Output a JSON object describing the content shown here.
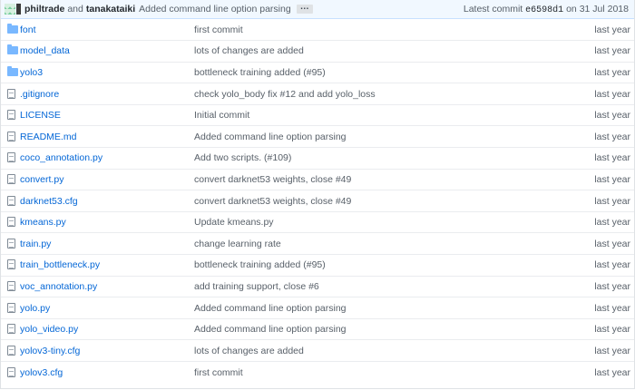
{
  "commit": {
    "author1": "philtrade",
    "and": "and",
    "author2": "tanakataiki",
    "message": "Added command line option parsing",
    "ellipsis": "…",
    "latest_label": "Latest commit",
    "sha": "e6598d1",
    "date": "on 31 Jul 2018"
  },
  "files": [
    {
      "type": "folder",
      "name": "font",
      "message": "first commit",
      "age": "last year"
    },
    {
      "type": "folder",
      "name": "model_data",
      "message": "lots of changes are added",
      "age": "last year"
    },
    {
      "type": "folder",
      "name": "yolo3",
      "message": "bottleneck training added (#95)",
      "age": "last year"
    },
    {
      "type": "file",
      "name": ".gitignore",
      "message": "check yolo_body fix #12 and add yolo_loss",
      "age": "last year"
    },
    {
      "type": "file",
      "name": "LICENSE",
      "message": "Initial commit",
      "age": "last year"
    },
    {
      "type": "file",
      "name": "README.md",
      "message": "Added command line option parsing",
      "age": "last year"
    },
    {
      "type": "file",
      "name": "coco_annotation.py",
      "message": "Add two scripts. (#109)",
      "age": "last year"
    },
    {
      "type": "file",
      "name": "convert.py",
      "message": "convert darknet53 weights, close #49",
      "age": "last year"
    },
    {
      "type": "file",
      "name": "darknet53.cfg",
      "message": "convert darknet53 weights, close #49",
      "age": "last year"
    },
    {
      "type": "file",
      "name": "kmeans.py",
      "message": "Update kmeans.py",
      "age": "last year"
    },
    {
      "type": "file",
      "name": "train.py",
      "message": "change learning rate",
      "age": "last year"
    },
    {
      "type": "file",
      "name": "train_bottleneck.py",
      "message": "bottleneck training added (#95)",
      "age": "last year"
    },
    {
      "type": "file",
      "name": "voc_annotation.py",
      "message": "add training support, close #6",
      "age": "last year"
    },
    {
      "type": "file",
      "name": "yolo.py",
      "message": "Added command line option parsing",
      "age": "last year"
    },
    {
      "type": "file",
      "name": "yolo_video.py",
      "message": "Added command line option parsing",
      "age": "last year"
    },
    {
      "type": "file",
      "name": "yolov3-tiny.cfg",
      "message": "lots of changes are added",
      "age": "last year"
    },
    {
      "type": "file",
      "name": "yolov3.cfg",
      "message": "first commit",
      "age": "last year"
    }
  ],
  "colors": {
    "link": "#0366d6",
    "commit_bar": "#f1f8ff",
    "folder": "#79b8ff"
  }
}
